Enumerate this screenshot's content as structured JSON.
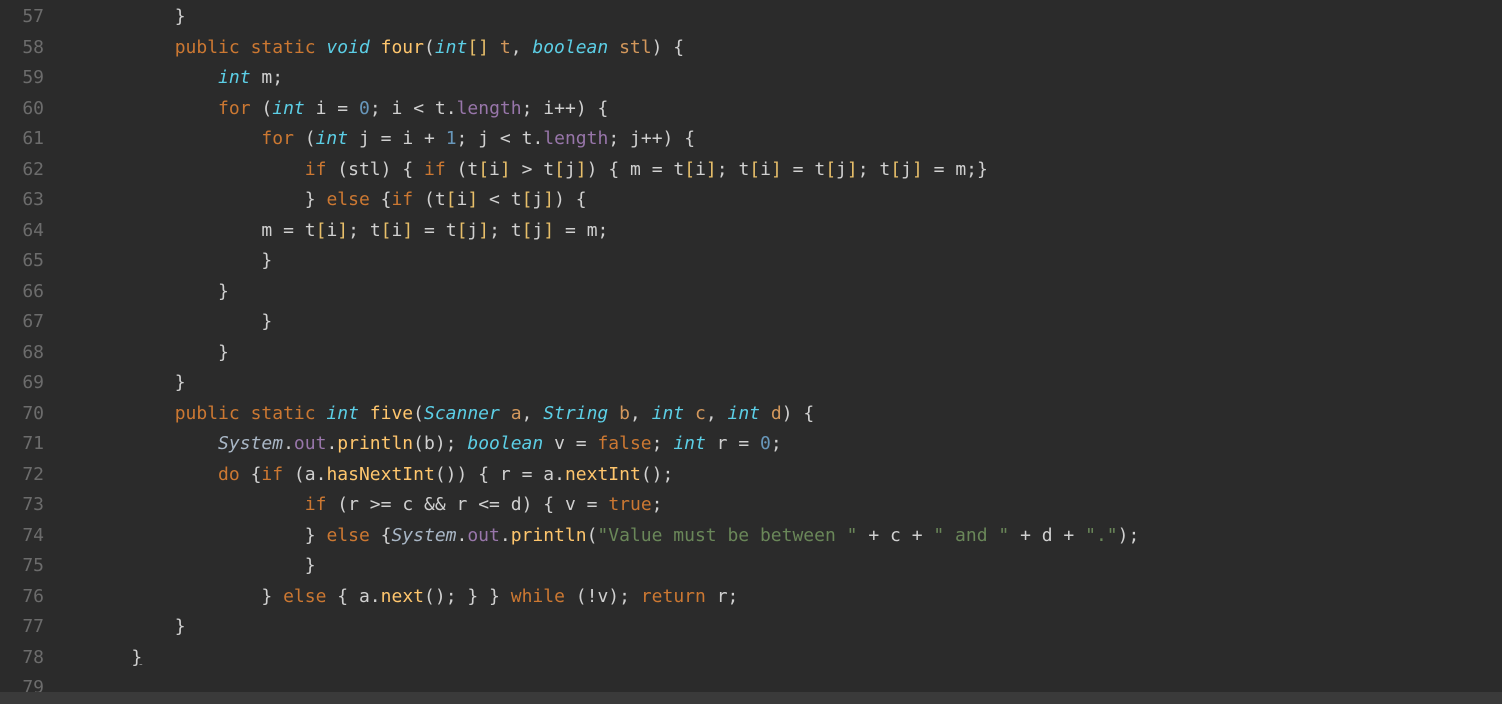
{
  "gutter": {
    "start": 57,
    "end": 79
  },
  "code": {
    "lines": [
      {
        "indent": 8,
        "tokens": [
          {
            "t": "}",
            "c": "curly"
          }
        ]
      },
      {
        "indent": 8,
        "tokens": [
          {
            "t": "public ",
            "c": "kw"
          },
          {
            "t": "static ",
            "c": "kw"
          },
          {
            "t": "void ",
            "c": "type"
          },
          {
            "t": "four",
            "c": "fn"
          },
          {
            "t": "(",
            "c": "paren"
          },
          {
            "t": "int",
            "c": "type"
          },
          {
            "t": "[] ",
            "c": "br"
          },
          {
            "t": "t",
            "c": "param"
          },
          {
            "t": ", ",
            "c": "op"
          },
          {
            "t": "boolean ",
            "c": "type"
          },
          {
            "t": "stl",
            "c": "param"
          },
          {
            "t": ") ",
            "c": "paren"
          },
          {
            "t": "{",
            "c": "curly"
          }
        ]
      },
      {
        "indent": 12,
        "tokens": [
          {
            "t": "int ",
            "c": "type"
          },
          {
            "t": "m",
            "c": "var"
          },
          {
            "t": ";",
            "c": "op"
          }
        ]
      },
      {
        "indent": 12,
        "tokens": [
          {
            "t": "for ",
            "c": "kw"
          },
          {
            "t": "(",
            "c": "paren"
          },
          {
            "t": "int ",
            "c": "type"
          },
          {
            "t": "i ",
            "c": "var"
          },
          {
            "t": "= ",
            "c": "op"
          },
          {
            "t": "0",
            "c": "num"
          },
          {
            "t": "; ",
            "c": "op"
          },
          {
            "t": "i ",
            "c": "var"
          },
          {
            "t": "< ",
            "c": "op"
          },
          {
            "t": "t",
            "c": "var"
          },
          {
            "t": ".",
            "c": "op"
          },
          {
            "t": "length",
            "c": "member"
          },
          {
            "t": "; ",
            "c": "op"
          },
          {
            "t": "i",
            "c": "var"
          },
          {
            "t": "++",
            "c": "op"
          },
          {
            "t": ") ",
            "c": "paren"
          },
          {
            "t": "{",
            "c": "curly"
          }
        ]
      },
      {
        "indent": 16,
        "tokens": [
          {
            "t": "for ",
            "c": "kw"
          },
          {
            "t": "(",
            "c": "paren"
          },
          {
            "t": "int ",
            "c": "type"
          },
          {
            "t": "j ",
            "c": "var"
          },
          {
            "t": "= ",
            "c": "op"
          },
          {
            "t": "i ",
            "c": "var"
          },
          {
            "t": "+ ",
            "c": "op"
          },
          {
            "t": "1",
            "c": "num"
          },
          {
            "t": "; ",
            "c": "op"
          },
          {
            "t": "j ",
            "c": "var"
          },
          {
            "t": "< ",
            "c": "op"
          },
          {
            "t": "t",
            "c": "var"
          },
          {
            "t": ".",
            "c": "op"
          },
          {
            "t": "length",
            "c": "member"
          },
          {
            "t": "; ",
            "c": "op"
          },
          {
            "t": "j",
            "c": "var"
          },
          {
            "t": "++",
            "c": "op"
          },
          {
            "t": ") ",
            "c": "paren"
          },
          {
            "t": "{",
            "c": "curly"
          }
        ]
      },
      {
        "indent": 20,
        "tokens": [
          {
            "t": "if ",
            "c": "kw"
          },
          {
            "t": "(",
            "c": "paren"
          },
          {
            "t": "stl",
            "c": "var"
          },
          {
            "t": ") ",
            "c": "paren"
          },
          {
            "t": "{ ",
            "c": "curly"
          },
          {
            "t": "if ",
            "c": "kw"
          },
          {
            "t": "(",
            "c": "paren"
          },
          {
            "t": "t",
            "c": "var"
          },
          {
            "t": "[",
            "c": "br"
          },
          {
            "t": "i",
            "c": "var"
          },
          {
            "t": "] ",
            "c": "br"
          },
          {
            "t": "> ",
            "c": "op"
          },
          {
            "t": "t",
            "c": "var"
          },
          {
            "t": "[",
            "c": "br"
          },
          {
            "t": "j",
            "c": "var"
          },
          {
            "t": "]",
            "c": "br"
          },
          {
            "t": ") ",
            "c": "paren"
          },
          {
            "t": "{ ",
            "c": "curly"
          },
          {
            "t": "m ",
            "c": "var"
          },
          {
            "t": "= ",
            "c": "op"
          },
          {
            "t": "t",
            "c": "var"
          },
          {
            "t": "[",
            "c": "br"
          },
          {
            "t": "i",
            "c": "var"
          },
          {
            "t": "]",
            "c": "br"
          },
          {
            "t": "; ",
            "c": "op"
          },
          {
            "t": "t",
            "c": "var"
          },
          {
            "t": "[",
            "c": "br"
          },
          {
            "t": "i",
            "c": "var"
          },
          {
            "t": "] ",
            "c": "br"
          },
          {
            "t": "= ",
            "c": "op"
          },
          {
            "t": "t",
            "c": "var"
          },
          {
            "t": "[",
            "c": "br"
          },
          {
            "t": "j",
            "c": "var"
          },
          {
            "t": "]",
            "c": "br"
          },
          {
            "t": "; ",
            "c": "op"
          },
          {
            "t": "t",
            "c": "var"
          },
          {
            "t": "[",
            "c": "br"
          },
          {
            "t": "j",
            "c": "var"
          },
          {
            "t": "] ",
            "c": "br"
          },
          {
            "t": "= ",
            "c": "op"
          },
          {
            "t": "m",
            "c": "var"
          },
          {
            "t": ";",
            "c": "op"
          },
          {
            "t": "}",
            "c": "curly"
          }
        ]
      },
      {
        "indent": 20,
        "tokens": [
          {
            "t": "} ",
            "c": "curly"
          },
          {
            "t": "else ",
            "c": "kw"
          },
          {
            "t": "{",
            "c": "curly"
          },
          {
            "t": "if ",
            "c": "kw"
          },
          {
            "t": "(",
            "c": "paren"
          },
          {
            "t": "t",
            "c": "var"
          },
          {
            "t": "[",
            "c": "br"
          },
          {
            "t": "i",
            "c": "var"
          },
          {
            "t": "] ",
            "c": "br"
          },
          {
            "t": "< ",
            "c": "op"
          },
          {
            "t": "t",
            "c": "var"
          },
          {
            "t": "[",
            "c": "br"
          },
          {
            "t": "j",
            "c": "var"
          },
          {
            "t": "]",
            "c": "br"
          },
          {
            "t": ") ",
            "c": "paren"
          },
          {
            "t": "{",
            "c": "curly"
          }
        ]
      },
      {
        "indent": 16,
        "tokens": [
          {
            "t": "m ",
            "c": "var"
          },
          {
            "t": "= ",
            "c": "op"
          },
          {
            "t": "t",
            "c": "var"
          },
          {
            "t": "[",
            "c": "br"
          },
          {
            "t": "i",
            "c": "var"
          },
          {
            "t": "]",
            "c": "br"
          },
          {
            "t": "; ",
            "c": "op"
          },
          {
            "t": "t",
            "c": "var"
          },
          {
            "t": "[",
            "c": "br"
          },
          {
            "t": "i",
            "c": "var"
          },
          {
            "t": "] ",
            "c": "br"
          },
          {
            "t": "= ",
            "c": "op"
          },
          {
            "t": "t",
            "c": "var"
          },
          {
            "t": "[",
            "c": "br"
          },
          {
            "t": "j",
            "c": "var"
          },
          {
            "t": "]",
            "c": "br"
          },
          {
            "t": "; ",
            "c": "op"
          },
          {
            "t": "t",
            "c": "var"
          },
          {
            "t": "[",
            "c": "br"
          },
          {
            "t": "j",
            "c": "var"
          },
          {
            "t": "] ",
            "c": "br"
          },
          {
            "t": "= ",
            "c": "op"
          },
          {
            "t": "m",
            "c": "var"
          },
          {
            "t": ";",
            "c": "op"
          }
        ]
      },
      {
        "indent": 16,
        "tokens": [
          {
            "t": "}",
            "c": "curly"
          }
        ]
      },
      {
        "indent": 12,
        "tokens": [
          {
            "t": "}",
            "c": "curly"
          }
        ]
      },
      {
        "indent": 16,
        "tokens": [
          {
            "t": "}",
            "c": "curly"
          }
        ]
      },
      {
        "indent": 12,
        "tokens": [
          {
            "t": "}",
            "c": "curly"
          }
        ]
      },
      {
        "indent": 8,
        "tokens": [
          {
            "t": "}",
            "c": "curly"
          }
        ]
      },
      {
        "indent": 8,
        "tokens": [
          {
            "t": "public ",
            "c": "kw"
          },
          {
            "t": "static ",
            "c": "kw"
          },
          {
            "t": "int ",
            "c": "type"
          },
          {
            "t": "five",
            "c": "fn"
          },
          {
            "t": "(",
            "c": "paren"
          },
          {
            "t": "Scanner ",
            "c": "type"
          },
          {
            "t": "a",
            "c": "param"
          },
          {
            "t": ", ",
            "c": "op"
          },
          {
            "t": "String ",
            "c": "type"
          },
          {
            "t": "b",
            "c": "param"
          },
          {
            "t": ", ",
            "c": "op"
          },
          {
            "t": "int ",
            "c": "type"
          },
          {
            "t": "c",
            "c": "param"
          },
          {
            "t": ", ",
            "c": "op"
          },
          {
            "t": "int ",
            "c": "type"
          },
          {
            "t": "d",
            "c": "param"
          },
          {
            "t": ") ",
            "c": "paren"
          },
          {
            "t": "{",
            "c": "curly"
          }
        ]
      },
      {
        "indent": 12,
        "tokens": [
          {
            "t": "System",
            "c": "cls"
          },
          {
            "t": ".",
            "c": "op"
          },
          {
            "t": "out",
            "c": "member"
          },
          {
            "t": ".",
            "c": "op"
          },
          {
            "t": "println",
            "c": "fn"
          },
          {
            "t": "(",
            "c": "paren"
          },
          {
            "t": "b",
            "c": "var"
          },
          {
            "t": ")",
            "c": "paren"
          },
          {
            "t": "; ",
            "c": "op"
          },
          {
            "t": "boolean ",
            "c": "type"
          },
          {
            "t": "v ",
            "c": "var"
          },
          {
            "t": "= ",
            "c": "op"
          },
          {
            "t": "false",
            "c": "bool"
          },
          {
            "t": "; ",
            "c": "op"
          },
          {
            "t": "int ",
            "c": "type"
          },
          {
            "t": "r ",
            "c": "var"
          },
          {
            "t": "= ",
            "c": "op"
          },
          {
            "t": "0",
            "c": "num"
          },
          {
            "t": ";",
            "c": "op"
          }
        ]
      },
      {
        "indent": 12,
        "tokens": [
          {
            "t": "do ",
            "c": "kw"
          },
          {
            "t": "{",
            "c": "curly"
          },
          {
            "t": "if ",
            "c": "kw"
          },
          {
            "t": "(",
            "c": "paren"
          },
          {
            "t": "a",
            "c": "var"
          },
          {
            "t": ".",
            "c": "op"
          },
          {
            "t": "hasNextInt",
            "c": "fn"
          },
          {
            "t": "()",
            "c": "paren"
          },
          {
            "t": ") ",
            "c": "paren"
          },
          {
            "t": "{ ",
            "c": "curly"
          },
          {
            "t": "r ",
            "c": "var"
          },
          {
            "t": "= ",
            "c": "op"
          },
          {
            "t": "a",
            "c": "var"
          },
          {
            "t": ".",
            "c": "op"
          },
          {
            "t": "nextInt",
            "c": "fn"
          },
          {
            "t": "()",
            "c": "paren"
          },
          {
            "t": ";",
            "c": "op"
          }
        ]
      },
      {
        "indent": 20,
        "tokens": [
          {
            "t": "if ",
            "c": "kw"
          },
          {
            "t": "(",
            "c": "paren"
          },
          {
            "t": "r ",
            "c": "var"
          },
          {
            "t": ">= ",
            "c": "op"
          },
          {
            "t": "c ",
            "c": "var"
          },
          {
            "t": "&& ",
            "c": "op"
          },
          {
            "t": "r ",
            "c": "var"
          },
          {
            "t": "<= ",
            "c": "op"
          },
          {
            "t": "d",
            "c": "var"
          },
          {
            "t": ") ",
            "c": "paren"
          },
          {
            "t": "{ ",
            "c": "curly"
          },
          {
            "t": "v ",
            "c": "var"
          },
          {
            "t": "= ",
            "c": "op"
          },
          {
            "t": "true",
            "c": "bool"
          },
          {
            "t": ";",
            "c": "op"
          }
        ]
      },
      {
        "indent": 20,
        "tokens": [
          {
            "t": "} ",
            "c": "curly"
          },
          {
            "t": "else ",
            "c": "kw"
          },
          {
            "t": "{",
            "c": "curly"
          },
          {
            "t": "System",
            "c": "cls"
          },
          {
            "t": ".",
            "c": "op"
          },
          {
            "t": "out",
            "c": "member"
          },
          {
            "t": ".",
            "c": "op"
          },
          {
            "t": "println",
            "c": "fn"
          },
          {
            "t": "(",
            "c": "paren"
          },
          {
            "t": "\"Value must be between \"",
            "c": "str"
          },
          {
            "t": " + ",
            "c": "op"
          },
          {
            "t": "c",
            "c": "var"
          },
          {
            "t": " + ",
            "c": "op"
          },
          {
            "t": "\" and \"",
            "c": "str"
          },
          {
            "t": " + ",
            "c": "op"
          },
          {
            "t": "d",
            "c": "var"
          },
          {
            "t": " + ",
            "c": "op"
          },
          {
            "t": "\".\"",
            "c": "str"
          },
          {
            "t": ")",
            "c": "paren"
          },
          {
            "t": ";",
            "c": "op"
          }
        ]
      },
      {
        "indent": 20,
        "tokens": [
          {
            "t": "}",
            "c": "curly"
          }
        ]
      },
      {
        "indent": 16,
        "tokens": [
          {
            "t": "} ",
            "c": "curly"
          },
          {
            "t": "else ",
            "c": "kw"
          },
          {
            "t": "{ ",
            "c": "curly"
          },
          {
            "t": "a",
            "c": "var"
          },
          {
            "t": ".",
            "c": "op"
          },
          {
            "t": "next",
            "c": "fn"
          },
          {
            "t": "()",
            "c": "paren"
          },
          {
            "t": "; ",
            "c": "op"
          },
          {
            "t": "} } ",
            "c": "curly"
          },
          {
            "t": "while ",
            "c": "kw"
          },
          {
            "t": "(",
            "c": "paren"
          },
          {
            "t": "!",
            "c": "op"
          },
          {
            "t": "v",
            "c": "var"
          },
          {
            "t": ")",
            "c": "paren"
          },
          {
            "t": "; ",
            "c": "op"
          },
          {
            "t": "return ",
            "c": "kw"
          },
          {
            "t": "r",
            "c": "var"
          },
          {
            "t": ";",
            "c": "op"
          }
        ]
      },
      {
        "indent": 8,
        "tokens": [
          {
            "t": "}",
            "c": "curly"
          }
        ]
      },
      {
        "indent": 4,
        "tokens": [
          {
            "t": "}",
            "c": "curly underline"
          }
        ]
      },
      {
        "indent": 0,
        "tokens": []
      }
    ]
  }
}
